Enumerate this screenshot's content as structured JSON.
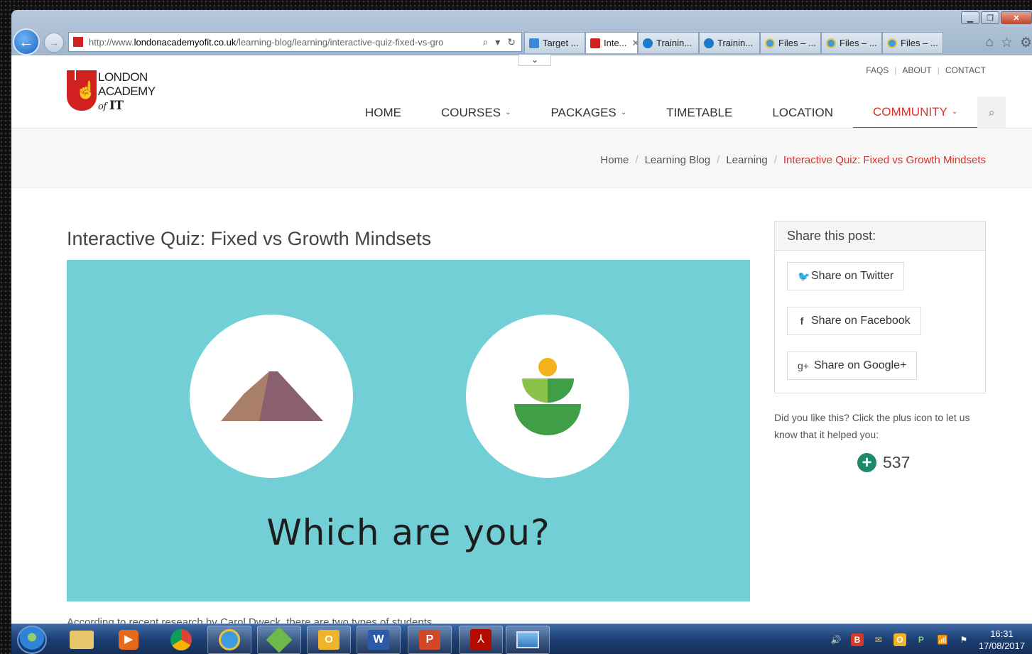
{
  "browser": {
    "url_prefix": "http://www.",
    "url_domain": "londonacademyofit.co.uk",
    "url_path": "/learning-blog/learning/interactive-quiz-fixed-vs-gro",
    "tabs": [
      {
        "label": "Target ...",
        "icon": "chart-icon"
      },
      {
        "label": "Inte...",
        "icon": "lait-icon",
        "active": true
      },
      {
        "label": "Trainin...",
        "icon": "p-icon"
      },
      {
        "label": "Trainin...",
        "icon": "p-icon"
      },
      {
        "label": "Files – ...",
        "icon": "ie-icon"
      },
      {
        "label": "Files – ...",
        "icon": "ie-icon"
      },
      {
        "label": "Files – ...",
        "icon": "ie-icon"
      }
    ]
  },
  "site": {
    "logo_line1": "LONDON",
    "logo_line2": "ACADEMY",
    "logo_of": "of",
    "logo_it": "IT",
    "top_links": [
      "FAQS",
      "ABOUT",
      "CONTACT"
    ],
    "nav": [
      {
        "label": "HOME"
      },
      {
        "label": "COURSES",
        "dropdown": true
      },
      {
        "label": "PACKAGES",
        "dropdown": true
      },
      {
        "label": "TIMETABLE"
      },
      {
        "label": "LOCATION"
      },
      {
        "label": "COMMUNITY",
        "dropdown": true,
        "active": true
      }
    ],
    "brand_color": "#d9322b"
  },
  "breadcrumb": {
    "home": "Home",
    "blog": "Learning Blog",
    "learning": "Learning",
    "current": "Interactive Quiz: Fixed vs Growth Mindsets"
  },
  "post": {
    "title": "Interactive Quiz: Fixed vs Growth Mindsets",
    "hero_text": "Which are you?",
    "hero_bg": "#72cfd6",
    "intro_cut": "According to recent research by Carol Dweck, there are two types of students"
  },
  "share": {
    "heading": "Share this post:",
    "twitter": "Share on Twitter",
    "facebook": "Share on Facebook",
    "google": "Share on Google+"
  },
  "like": {
    "text": "Did you like this? Click the plus icon to let us know that it helped you:",
    "count": "537"
  },
  "taskbar": {
    "time": "16:31",
    "date": "17/08/2017"
  }
}
